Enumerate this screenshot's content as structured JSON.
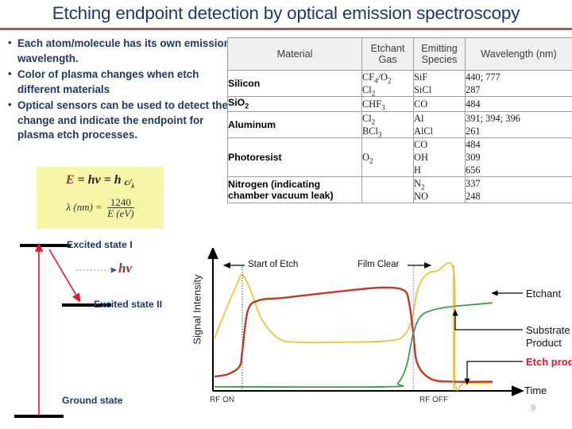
{
  "slide": {
    "title": "Etching endpoint detection by optical emission spectroscopy",
    "page_number": "9",
    "accent_rule_color": "#b5564a",
    "title_color": "#1f3864"
  },
  "bullets": [
    "Each atom/molecule has its own emission wavelength.",
    "Color of plasma changes when etch different materials",
    "Optical sensors can be used to detect the change and indicate the endpoint for plasma etch processes."
  ],
  "equation": {
    "line1_prefix": "E",
    "line1_rest": " = hv = h ",
    "line1_c": "c",
    "line1_lambda": "λ",
    "line2_left": "λ (nm)  = ",
    "line2_numerator": "1240",
    "line2_denominator": "E (eV)",
    "box_color": "#f7f6a8",
    "E_color": "#963634"
  },
  "table": {
    "headers": [
      "Material",
      "Etchant Gas",
      "Emitting Species",
      "Wavelength (nm)"
    ],
    "rows": [
      {
        "material": "Silicon",
        "gas": [
          "CF4/O2",
          "Cl2"
        ],
        "species": [
          "SiF",
          "SiCl"
        ],
        "wavelength": [
          "440; 777",
          "287"
        ]
      },
      {
        "material": "SiO2",
        "gas": [
          "CHF3"
        ],
        "species": [
          "CO"
        ],
        "wavelength": [
          "484"
        ]
      },
      {
        "material": "Aluminum",
        "gas": [
          "Cl2",
          "BCl3"
        ],
        "species": [
          "Al",
          "AlCl"
        ],
        "wavelength": [
          "391; 394; 396",
          "261"
        ]
      },
      {
        "material": "Photoresist",
        "gas": [
          "O2"
        ],
        "species": [
          "CO",
          "OH",
          "H"
        ],
        "wavelength": [
          "484",
          "309",
          "656"
        ]
      },
      {
        "material": "Nitrogen (indicating chamber vacuum leak)",
        "gas": [],
        "species": [
          "N2",
          "NO"
        ],
        "wavelength": [
          "337",
          "248"
        ]
      }
    ]
  },
  "energy_diagram": {
    "excited_state_1": "Excited state I",
    "excited_state_2": "Excited state II",
    "ground_state": "Ground state",
    "photon_label": "hv",
    "arrow_color": "#e8112d",
    "label_color": "#1f3864"
  },
  "chart_data": {
    "type": "line",
    "title": "",
    "xlabel": "Time",
    "ylabel": "Signal Intensity",
    "grid": false,
    "legend_position": "right",
    "axis_ticks_x": [
      "RF ON",
      "RF OFF"
    ],
    "annotations": [
      {
        "text": "Start of Etch",
        "at": "RF ON"
      },
      {
        "text": "Film Clear",
        "at": "Film clear marker"
      }
    ],
    "markers": [
      {
        "name": "RF ON",
        "x": 0.1,
        "color": "#1f7a3f",
        "style": "dotted"
      },
      {
        "name": "Film Clear",
        "x": 0.715,
        "color": "#8f7fd4",
        "style": "dotted"
      },
      {
        "name": "RF OFF",
        "x": 0.86,
        "color": "#e8b33a",
        "style": "solid"
      }
    ],
    "series": [
      {
        "name": "Etchant",
        "color": "#ecc63a",
        "label_color": "#111111",
        "x": [
          0.0,
          0.04,
          0.08,
          0.1,
          0.13,
          0.17,
          0.23,
          0.3,
          0.45,
          0.62,
          0.68,
          0.71,
          0.73,
          0.76,
          0.8,
          0.86,
          0.865,
          0.9,
          1.0
        ],
        "y": [
          0.4,
          0.62,
          0.82,
          0.9,
          0.78,
          0.55,
          0.4,
          0.37,
          0.37,
          0.38,
          0.42,
          0.55,
          0.78,
          0.9,
          0.93,
          0.93,
          0.06,
          0.05,
          0.05
        ]
      },
      {
        "name": "Etch product",
        "color": "#c23a22",
        "label_color": "#e8112d",
        "label_bold": true,
        "x": [
          0.0,
          0.05,
          0.09,
          0.1,
          0.12,
          0.16,
          0.25,
          0.45,
          0.6,
          0.68,
          0.7,
          0.715,
          0.73,
          0.78,
          0.86,
          1.0
        ],
        "y": [
          0.1,
          0.12,
          0.18,
          0.3,
          0.62,
          0.7,
          0.72,
          0.77,
          0.8,
          0.78,
          0.68,
          0.44,
          0.2,
          0.08,
          0.06,
          0.06
        ]
      },
      {
        "name": "Substrate Product",
        "color": "#3c9d4e",
        "label_color": "#111111",
        "x": [
          0.0,
          0.62,
          0.66,
          0.69,
          0.715,
          0.74,
          0.78,
          0.85,
          0.95,
          1.0
        ],
        "y": [
          0.02,
          0.02,
          0.05,
          0.18,
          0.44,
          0.57,
          0.62,
          0.65,
          0.67,
          0.68
        ]
      }
    ]
  },
  "plot_labels": {
    "start_of_etch": "Start of Etch",
    "film_clear": "Film Clear",
    "rf_on": "RF ON",
    "rf_off": "RF OFF",
    "time": "Time",
    "signal_intensity": "Signal Intensity",
    "etchant": "Etchant",
    "substrate_product_line1": "Substrate",
    "substrate_product_line2": "Product",
    "etch_product": "Etch product"
  }
}
